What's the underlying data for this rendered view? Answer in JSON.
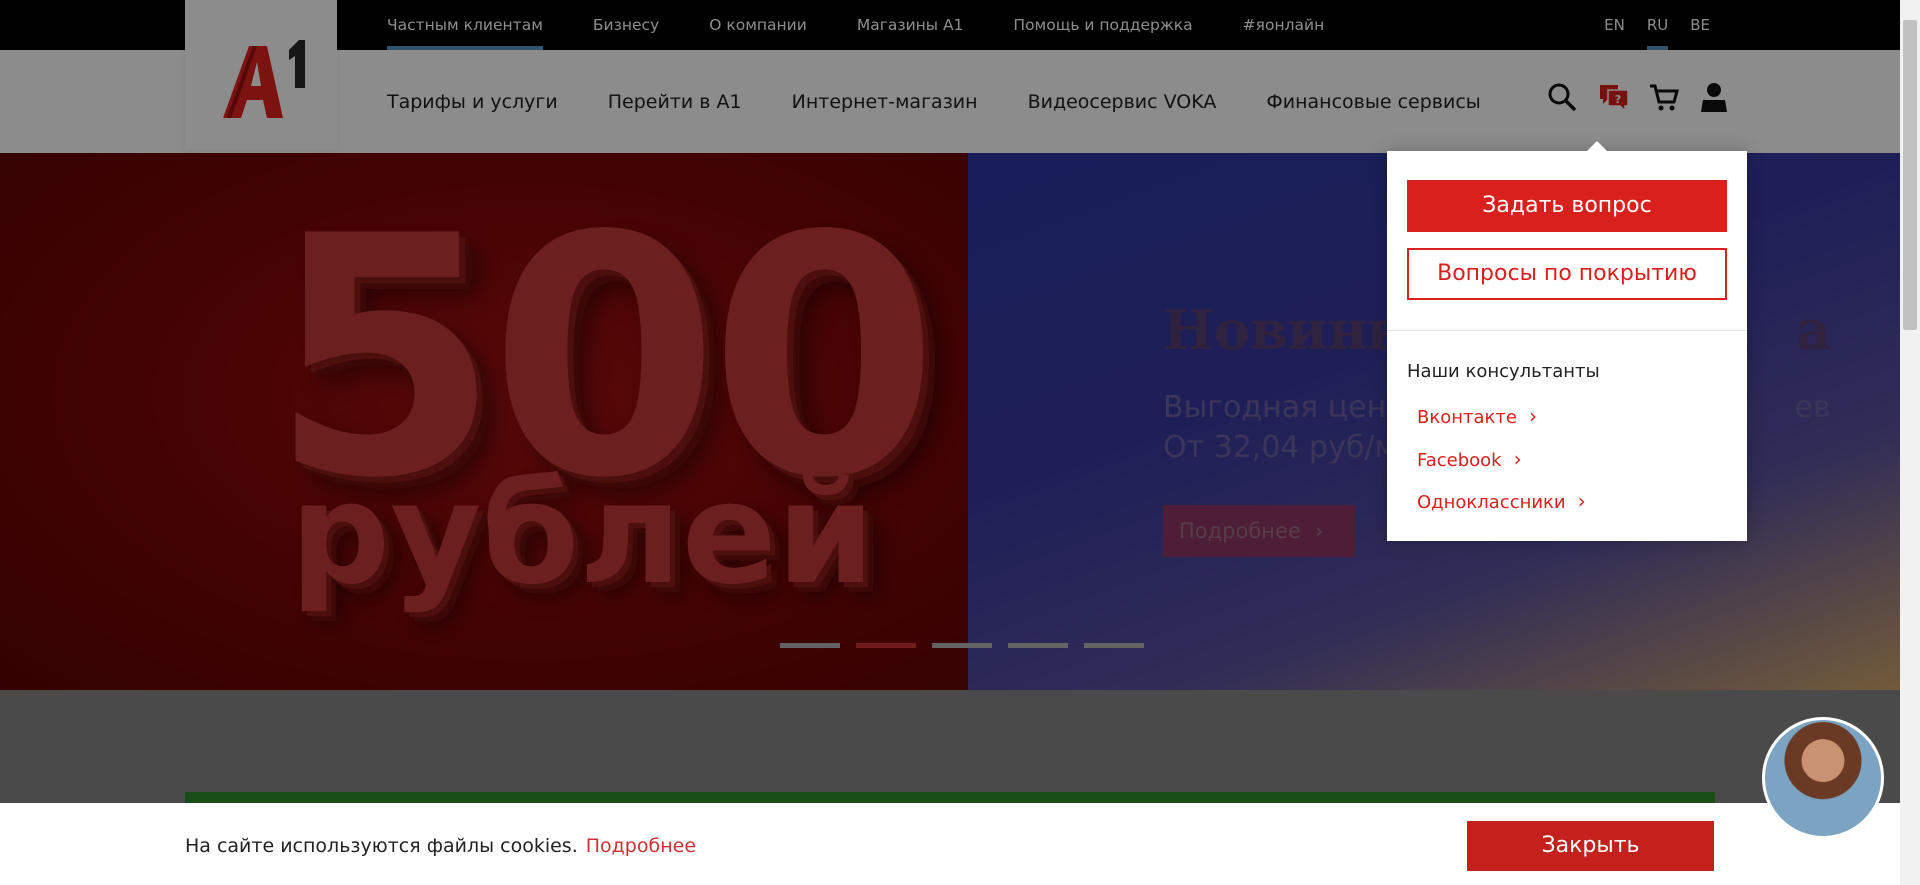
{
  "top_nav": {
    "items": [
      {
        "label": "Частным клиентам",
        "active": true
      },
      {
        "label": "Бизнесу",
        "active": false
      },
      {
        "label": "О компании",
        "active": false
      },
      {
        "label": "Магазины А1",
        "active": false
      },
      {
        "label": "Помощь и поддержка",
        "active": false
      },
      {
        "label": "#яонлайн",
        "active": false
      }
    ]
  },
  "languages": {
    "items": [
      "EN",
      "RU",
      "BE"
    ],
    "active": "RU"
  },
  "main_nav": {
    "items": [
      "Тарифы и услуги",
      "Перейти в А1",
      "Интернет-магазин",
      "Видеосервис VOKA",
      "Финансовые сервисы"
    ]
  },
  "header_icons": [
    "search-icon",
    "chat-question-icon",
    "cart-icon",
    "user-icon"
  ],
  "hero": {
    "left_big_number": "500",
    "left_word": "рублей",
    "right_title": "Новинк",
    "right_title_tail": "а",
    "right_subtitle_line1": "Выгодная цена",
    "right_subtitle_line1_tail": "ев",
    "right_subtitle_line2": "От 32,04 руб/м",
    "right_button": "Подробнее",
    "slide_count": 5,
    "active_slide": 2
  },
  "help_popup": {
    "ask_button": "Задать вопрос",
    "coverage_button": "Вопросы по покрытию",
    "consultants_heading": "Наши консультанты",
    "links": [
      "Вконтакте",
      "Facebook",
      "Одноклассники"
    ]
  },
  "cookie_bar": {
    "text": "На сайте используются файлы cookies.",
    "link": "Подробнее",
    "close_button": "Закрыть"
  },
  "colors": {
    "brand_red": "#d9201c",
    "top_bar": "#000000",
    "active_underline": "#5b97c8"
  }
}
